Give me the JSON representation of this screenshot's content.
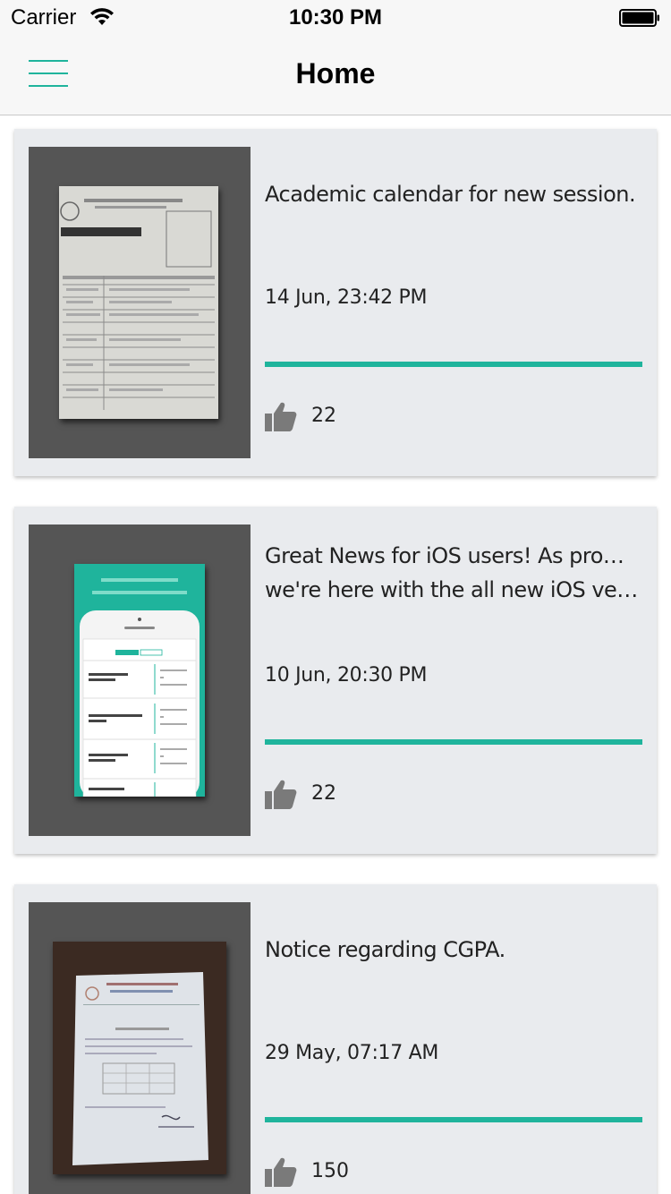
{
  "status_bar": {
    "carrier": "Carrier",
    "time": "10:30 PM"
  },
  "nav": {
    "title": "Home",
    "menu_icon": "hamburger-menu-icon",
    "accent_color": "#1fb49c"
  },
  "posts": [
    {
      "title_lines": [
        "Academic calendar for new session."
      ],
      "date": "14 Jun, 23:42 PM",
      "likes": "22",
      "thumbnail": "academic-calendar-document-photo"
    },
    {
      "title_lines": [
        "Great News for iOS users! As promised,",
        "we're here with the all new iOS version o…"
      ],
      "date": "10 Jun, 20:30 PM",
      "likes": "22",
      "thumbnail": "ios-app-screenshot"
    },
    {
      "title_lines": [
        "Notice regarding CGPA."
      ],
      "date": "29 May, 07:17 AM",
      "likes": "150",
      "thumbnail": "cgpa-notice-document-photo"
    }
  ]
}
